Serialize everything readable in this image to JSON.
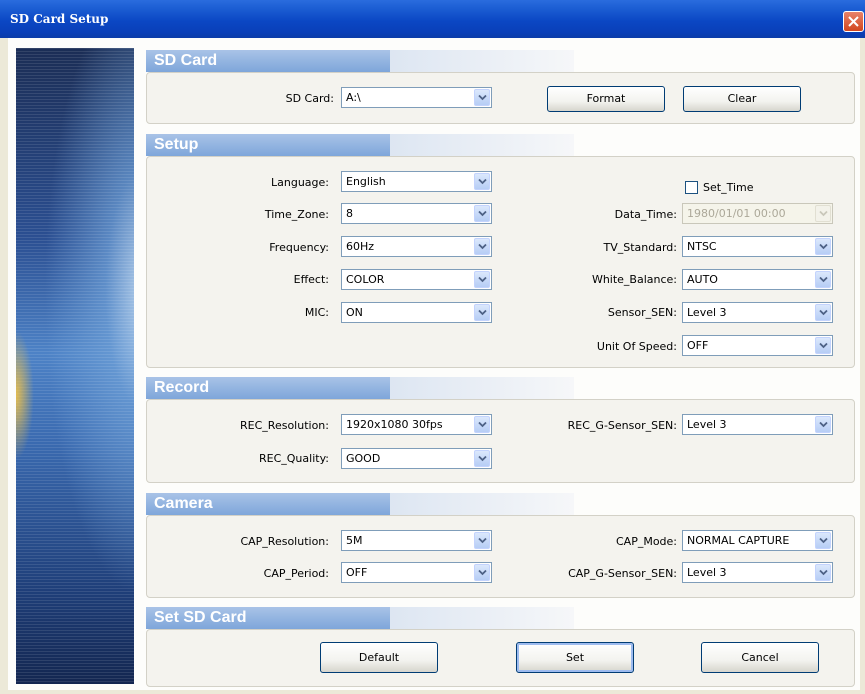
{
  "window": {
    "title": "SD Card Setup"
  },
  "sections": {
    "sd_card": "SD Card",
    "setup": "Setup",
    "record": "Record",
    "camera": "Camera",
    "set_sd_card": "Set SD Card"
  },
  "sd_card": {
    "label": "SD Card:",
    "value": "A:\\",
    "format_button": "Format",
    "clear_button": "Clear"
  },
  "setup": {
    "language": {
      "label": "Language:",
      "value": "English"
    },
    "time_zone": {
      "label": "Time_Zone:",
      "value": "8"
    },
    "frequency": {
      "label": "Frequency:",
      "value": "60Hz"
    },
    "effect": {
      "label": "Effect:",
      "value": "COLOR"
    },
    "mic": {
      "label": "MIC:",
      "value": "ON"
    },
    "set_time": {
      "label": "Set_Time",
      "checked": false
    },
    "data_time": {
      "label": "Data_Time:",
      "value": "1980/01/01 00:00",
      "disabled": true
    },
    "tv_standard": {
      "label": "TV_Standard:",
      "value": "NTSC"
    },
    "white_balance": {
      "label": "White_Balance:",
      "value": "AUTO"
    },
    "sensor_sen": {
      "label": "Sensor_SEN:",
      "value": "Level 3"
    },
    "unit_of_speed": {
      "label": "Unit Of Speed:",
      "value": "OFF"
    }
  },
  "record": {
    "rec_resolution": {
      "label": "REC_Resolution:",
      "value": "1920x1080 30fps"
    },
    "rec_quality": {
      "label": "REC_Quality:",
      "value": "GOOD"
    },
    "rec_g_sensor_sen": {
      "label": "REC_G-Sensor_SEN:",
      "value": "Level 3"
    }
  },
  "camera": {
    "cap_resolution": {
      "label": "CAP_Resolution:",
      "value": "5M"
    },
    "cap_period": {
      "label": "CAP_Period:",
      "value": "OFF"
    },
    "cap_mode": {
      "label": "CAP_Mode:",
      "value": "NORMAL CAPTURE"
    },
    "cap_g_sensor_sen": {
      "label": "CAP_G-Sensor_SEN:",
      "value": "Level 3"
    }
  },
  "actions": {
    "default_button": "Default",
    "set_button": "Set",
    "cancel_button": "Cancel"
  },
  "colors": {
    "title_bar": "#0b47c4",
    "section_header": "#7ea6da",
    "close_button": "#d2461e",
    "dialog_bg": "#ece9d8"
  },
  "icons": {
    "close": "close-icon",
    "dropdown": "chevron-down-icon"
  }
}
